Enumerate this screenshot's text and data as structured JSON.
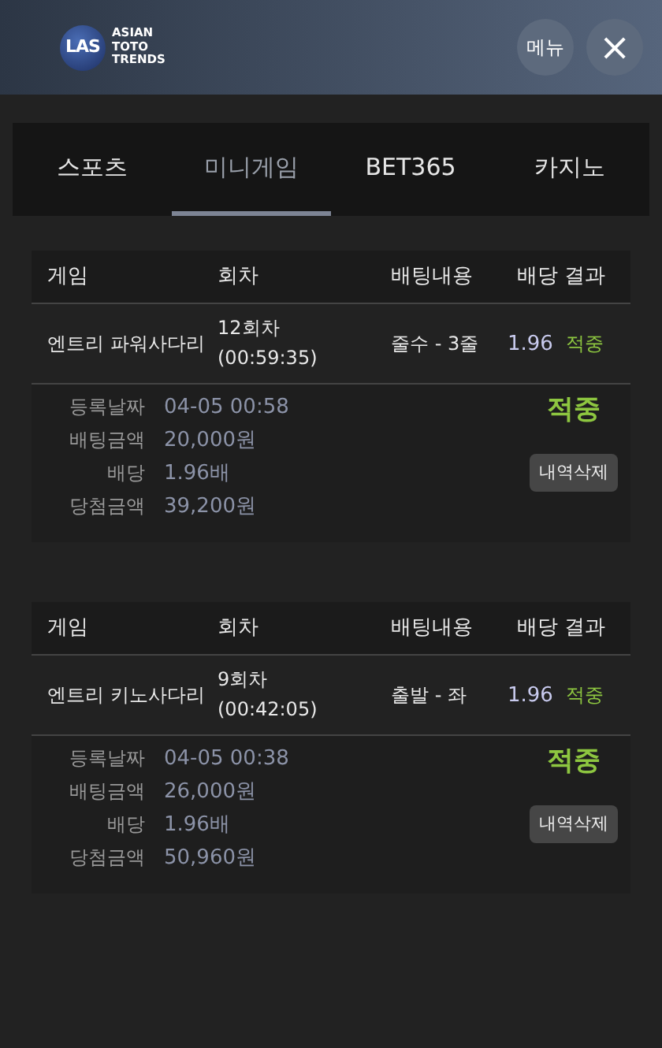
{
  "header": {
    "logo_mark": "LAS",
    "logo_lines": [
      "ASIAN",
      "TOTO",
      "TRENDS"
    ],
    "menu_button": "메뉴",
    "close_button": "×"
  },
  "tabs": [
    {
      "label": "스포츠",
      "selected": false
    },
    {
      "label": "미니게임",
      "selected": true
    },
    {
      "label": "BET365",
      "selected": false
    },
    {
      "label": "카지노",
      "selected": false
    }
  ],
  "bets": [
    {
      "columns": [
        "게임",
        "회차",
        "배팅내용",
        "배당",
        "결과"
      ],
      "game": "엔트리 파워사다리",
      "round": "12회차",
      "round_time": "(00:59:35)",
      "pick": "줄수 - 3줄",
      "odds": "1.96",
      "result": "적중",
      "details": [
        {
          "label": "등록날짜",
          "value": "04-05 00:58"
        },
        {
          "label": "배팅금액",
          "value": "20,000원"
        },
        {
          "label": "배당",
          "value": "1.96배"
        },
        {
          "label": "당첨금액",
          "value": "39,200원"
        }
      ],
      "status": "적중",
      "delete_button": "내역삭제"
    },
    {
      "columns": [
        "게임",
        "회차",
        "배팅내용",
        "배당",
        "결과"
      ],
      "game": "엔트리 키노사다리",
      "round": "9회차",
      "round_time": "(00:42:05)",
      "pick": "출발 - 좌",
      "odds": "1.96",
      "result": "적중",
      "details": [
        {
          "label": "등록날짜",
          "value": "04-05 00:38"
        },
        {
          "label": "배팅금액",
          "value": "26,000원"
        },
        {
          "label": "배당",
          "value": "1.96배"
        },
        {
          "label": "당첨금액",
          "value": "50,960원"
        }
      ],
      "status": "적중",
      "delete_button": "내역삭제"
    }
  ]
}
